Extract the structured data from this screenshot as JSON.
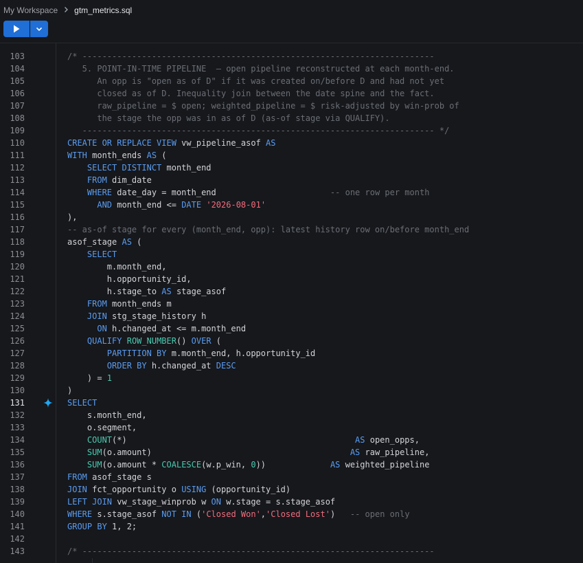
{
  "breadcrumb": {
    "workspace": "My Workspace",
    "file": "gtm_metrics.sql"
  },
  "active_line": "131",
  "code_lines": [
    {
      "n": "103",
      "t": [
        [
          "cm",
          "/* -----------------------------------------------------------------------"
        ]
      ]
    },
    {
      "n": "104",
      "t": [
        [
          "cm",
          "   5. POINT-IN-TIME PIPELINE  — open pipeline reconstructed at each month-end."
        ]
      ]
    },
    {
      "n": "105",
      "t": [
        [
          "cm",
          "      An opp is \"open as of D\" if it was created on/before D and had not yet"
        ]
      ]
    },
    {
      "n": "106",
      "t": [
        [
          "cm",
          "      closed as of D. Inequality join between the date spine and the fact."
        ]
      ]
    },
    {
      "n": "107",
      "t": [
        [
          "cm",
          "      raw_pipeline = $ open; weighted_pipeline = $ risk-adjusted by win-prob of"
        ]
      ]
    },
    {
      "n": "108",
      "t": [
        [
          "cm",
          "      the stage the opp was in as of D (as-of stage via QUALIFY)."
        ]
      ]
    },
    {
      "n": "109",
      "t": [
        [
          "cm",
          "   ----------------------------------------------------------------------- */"
        ]
      ]
    },
    {
      "n": "110",
      "t": [
        [
          "kw",
          "CREATE OR REPLACE VIEW"
        ],
        [
          "id",
          " vw_pipeline_asof "
        ],
        [
          "kw",
          "AS"
        ]
      ]
    },
    {
      "n": "111",
      "t": [
        [
          "kw",
          "WITH"
        ],
        [
          "id",
          " month_ends "
        ],
        [
          "kw",
          "AS"
        ],
        [
          "id",
          " ("
        ]
      ]
    },
    {
      "n": "112",
      "t": [
        [
          "id",
          "    "
        ],
        [
          "kw",
          "SELECT DISTINCT"
        ],
        [
          "id",
          " month_end"
        ]
      ]
    },
    {
      "n": "113",
      "t": [
        [
          "id",
          "    "
        ],
        [
          "kw",
          "FROM"
        ],
        [
          "id",
          " dim_date"
        ]
      ]
    },
    {
      "n": "114",
      "t": [
        [
          "id",
          "    "
        ],
        [
          "kw",
          "WHERE"
        ],
        [
          "id",
          " date_day = month_end                       "
        ],
        [
          "cm",
          "-- one row per month"
        ]
      ]
    },
    {
      "n": "115",
      "t": [
        [
          "id",
          "      "
        ],
        [
          "kw",
          "AND"
        ],
        [
          "id",
          " month_end <= "
        ],
        [
          "kw",
          "DATE"
        ],
        [
          "id",
          " "
        ],
        [
          "str",
          "'2026-08-01'"
        ]
      ]
    },
    {
      "n": "116",
      "t": [
        [
          "id",
          "),"
        ]
      ]
    },
    {
      "n": "117",
      "t": [
        [
          "cm",
          "-- as-of stage for every (month_end, opp): latest history row on/before month_end"
        ]
      ]
    },
    {
      "n": "118",
      "t": [
        [
          "id",
          "asof_stage "
        ],
        [
          "kw",
          "AS"
        ],
        [
          "id",
          " ("
        ]
      ]
    },
    {
      "n": "119",
      "t": [
        [
          "id",
          "    "
        ],
        [
          "kw",
          "SELECT"
        ]
      ]
    },
    {
      "n": "120",
      "t": [
        [
          "id",
          "        m.month_end,"
        ]
      ]
    },
    {
      "n": "121",
      "t": [
        [
          "id",
          "        h.opportunity_id,"
        ]
      ]
    },
    {
      "n": "122",
      "t": [
        [
          "id",
          "        h.stage_to "
        ],
        [
          "kw",
          "AS"
        ],
        [
          "id",
          " stage_asof"
        ]
      ]
    },
    {
      "n": "123",
      "t": [
        [
          "id",
          "    "
        ],
        [
          "kw",
          "FROM"
        ],
        [
          "id",
          " month_ends m"
        ]
      ]
    },
    {
      "n": "124",
      "t": [
        [
          "id",
          "    "
        ],
        [
          "kw",
          "JOIN"
        ],
        [
          "id",
          " stg_stage_history h"
        ]
      ]
    },
    {
      "n": "125",
      "t": [
        [
          "id",
          "      "
        ],
        [
          "kw",
          "ON"
        ],
        [
          "id",
          " h.changed_at <= m.month_end"
        ]
      ]
    },
    {
      "n": "126",
      "t": [
        [
          "id",
          "    "
        ],
        [
          "kw",
          "QUALIFY"
        ],
        [
          "id",
          " "
        ],
        [
          "fn",
          "ROW_NUMBER"
        ],
        [
          "id",
          "() "
        ],
        [
          "kw",
          "OVER"
        ],
        [
          "id",
          " ("
        ]
      ]
    },
    {
      "n": "127",
      "t": [
        [
          "id",
          "        "
        ],
        [
          "kw",
          "PARTITION BY"
        ],
        [
          "id",
          " m.month_end, h.opportunity_id"
        ]
      ]
    },
    {
      "n": "128",
      "t": [
        [
          "id",
          "        "
        ],
        [
          "kw",
          "ORDER BY"
        ],
        [
          "id",
          " h.changed_at "
        ],
        [
          "kw",
          "DESC"
        ]
      ]
    },
    {
      "n": "129",
      "t": [
        [
          "id",
          "    ) = "
        ],
        [
          "num",
          "1"
        ]
      ]
    },
    {
      "n": "130",
      "t": [
        [
          "id",
          ")"
        ]
      ]
    },
    {
      "n": "131",
      "t": [
        [
          "kw",
          "SELECT"
        ]
      ]
    },
    {
      "n": "132",
      "t": [
        [
          "id",
          "    s.month_end,"
        ]
      ]
    },
    {
      "n": "133",
      "t": [
        [
          "id",
          "    o.segment,"
        ]
      ]
    },
    {
      "n": "134",
      "t": [
        [
          "id",
          "    "
        ],
        [
          "fn",
          "COUNT"
        ],
        [
          "id",
          "(*)                                              "
        ],
        [
          "kw",
          "AS"
        ],
        [
          "id",
          " open_opps,"
        ]
      ]
    },
    {
      "n": "135",
      "t": [
        [
          "id",
          "    "
        ],
        [
          "fn",
          "SUM"
        ],
        [
          "id",
          "(o.amount)                                        "
        ],
        [
          "kw",
          "AS"
        ],
        [
          "id",
          " raw_pipeline,"
        ]
      ]
    },
    {
      "n": "136",
      "t": [
        [
          "id",
          "    "
        ],
        [
          "fn",
          "SUM"
        ],
        [
          "id",
          "(o.amount * "
        ],
        [
          "fn",
          "COALESCE"
        ],
        [
          "id",
          "(w.p_win, "
        ],
        [
          "num",
          "0"
        ],
        [
          "id",
          "))             "
        ],
        [
          "kw",
          "AS"
        ],
        [
          "id",
          " weighted_pipeline"
        ]
      ]
    },
    {
      "n": "137",
      "t": [
        [
          "kw",
          "FROM"
        ],
        [
          "id",
          " asof_stage s"
        ]
      ]
    },
    {
      "n": "138",
      "t": [
        [
          "kw",
          "JOIN"
        ],
        [
          "id",
          " fct_opportunity o "
        ],
        [
          "kw",
          "USING"
        ],
        [
          "id",
          " (opportunity_id)"
        ]
      ]
    },
    {
      "n": "139",
      "t": [
        [
          "kw",
          "LEFT JOIN"
        ],
        [
          "id",
          " vw_stage_winprob w "
        ],
        [
          "kw",
          "ON"
        ],
        [
          "id",
          " w.stage = s.stage_asof"
        ]
      ]
    },
    {
      "n": "140",
      "t": [
        [
          "kw",
          "WHERE"
        ],
        [
          "id",
          " s.stage_asof "
        ],
        [
          "kw",
          "NOT IN"
        ],
        [
          "id",
          " ("
        ],
        [
          "str",
          "'Closed Won'"
        ],
        [
          "id",
          ","
        ],
        [
          "str",
          "'Closed Lost'"
        ],
        [
          "id",
          ")   "
        ],
        [
          "cm",
          "-- open only"
        ]
      ]
    },
    {
      "n": "141",
      "t": [
        [
          "kw",
          "GROUP BY"
        ],
        [
          "id",
          " 1, 2;"
        ]
      ]
    },
    {
      "n": "142",
      "t": [
        [
          "id",
          ""
        ]
      ]
    },
    {
      "n": "143",
      "t": [
        [
          "cm",
          "/* -----------------------------------------------------------------------"
        ]
      ]
    }
  ],
  "colors": {
    "background": "#16181c",
    "run_button": "#1f6fd6",
    "keyword": "#5b9cf0",
    "function": "#4cc9b0",
    "string": "#f26d7d",
    "comment": "#6b6e75",
    "ai_sparkle": "#1ea7f5"
  },
  "icons": {
    "run": "play-icon",
    "run_menu": "chevron-down-icon",
    "breadcrumb_separator": "chevron-right-icon",
    "gutter_action": "sparkle-icon"
  }
}
